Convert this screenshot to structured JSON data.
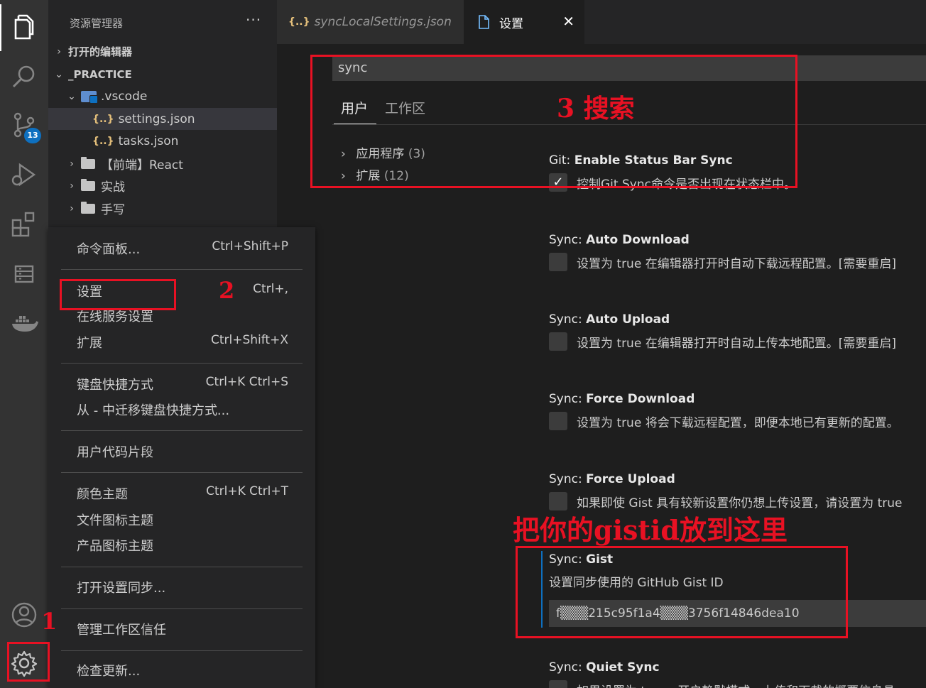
{
  "activity_bar": {
    "icons": [
      "explorer-icon",
      "search-icon",
      "source-control-icon",
      "run-debug-icon",
      "extensions-icon",
      "remote-explorer-icon",
      "docker-icon",
      "account-icon",
      "gear-icon"
    ],
    "source_control_badge": "13"
  },
  "explorer": {
    "title": "资源管理器",
    "more": "···",
    "open_editors": "打开的编辑器",
    "root_folder": "_PRACTICE",
    "vscode_folder": ".vscode",
    "files": [
      "settings.json",
      "tasks.json"
    ],
    "folders": [
      "【前端】React",
      "实战",
      "手写"
    ],
    "json_glyph": "{..}",
    "chevron_right": "›",
    "chevron_down": "⌄"
  },
  "tabs": {
    "inactive_tab": "syncLocalSettings.json",
    "active_tab": "设置",
    "close": "✕"
  },
  "settings": {
    "search_value": "sync",
    "scopes": [
      "用户",
      "工作区"
    ],
    "toc": [
      {
        "label": "应用程序",
        "count": "(3)"
      },
      {
        "label": "扩展",
        "count": "(12)"
      }
    ],
    "items": [
      {
        "category": "Git: ",
        "name": "Enable Status Bar Sync",
        "desc": "控制Git Sync命令是否出现在状态栏中。",
        "checked": "✓"
      },
      {
        "category": "Sync: ",
        "name": "Auto Download",
        "desc": "设置为 true 在编辑器打开时自动下载远程配置。[需要重启]",
        "checked": ""
      },
      {
        "category": "Sync: ",
        "name": "Auto Upload",
        "desc": "设置为 true 在编辑器打开时自动上传本地配置。[需要重启]",
        "checked": ""
      },
      {
        "category": "Sync: ",
        "name": "Force Download",
        "desc": "设置为 true 将会下载远程配置，即便本地已有更新的配置。",
        "checked": ""
      },
      {
        "category": "Sync: ",
        "name": "Force Upload",
        "desc": "如果即使 Gist 具有较新设置你仍想上传设置，请设置为 true",
        "checked": ""
      }
    ],
    "gist": {
      "category": "Sync: ",
      "name": "Gist",
      "desc": "设置同步使用的 GitHub Gist ID",
      "value": "f▒▒▒215c95f1a4▒▒▒3756f14846dea10"
    },
    "quiet_sync": {
      "category": "Sync: ",
      "name": "Quiet Sync",
      "desc": "如果设置为 true，开启静默模式，上传和下载的概要信息具"
    }
  },
  "menu": {
    "items": [
      {
        "label": "命令面板...",
        "shortcut": "Ctrl+Shift+P"
      },
      {
        "label": "设置",
        "shortcut": "Ctrl+,"
      },
      {
        "label": "在线服务设置",
        "shortcut": ""
      },
      {
        "label": "扩展",
        "shortcut": "Ctrl+Shift+X"
      },
      {
        "label": "键盘快捷方式",
        "shortcut": "Ctrl+K Ctrl+S"
      },
      {
        "label": "从 - 中迁移键盘快捷方式...",
        "shortcut": ""
      },
      {
        "label": "用户代码片段",
        "shortcut": ""
      },
      {
        "label": "颜色主题",
        "shortcut": "Ctrl+K Ctrl+T"
      },
      {
        "label": "文件图标主题",
        "shortcut": ""
      },
      {
        "label": "产品图标主题",
        "shortcut": ""
      },
      {
        "label": "打开设置同步...",
        "shortcut": ""
      },
      {
        "label": "管理工作区信任",
        "shortcut": ""
      },
      {
        "label": "检查更新...",
        "shortcut": ""
      }
    ]
  },
  "annotations": {
    "step1": "1",
    "step2": "2",
    "step3": "3 搜索",
    "gist_hint": "把你的gistid放到这里",
    "color": "#e81123"
  }
}
